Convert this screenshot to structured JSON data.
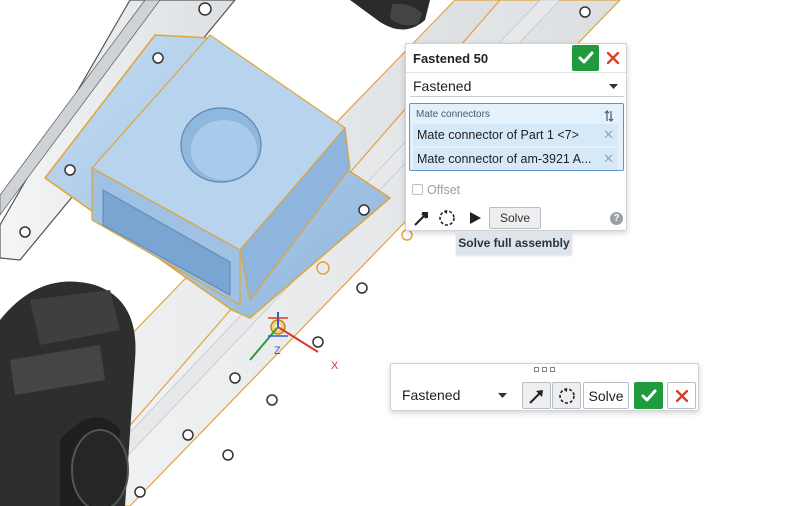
{
  "viewport": {
    "axis_label_x": "X",
    "axis_label_z": "Z"
  },
  "dialog": {
    "title": "Fastened 50",
    "mate_type": "Fastened",
    "connectors_label": "Mate connectors",
    "connectors": [
      "Mate connector of Part 1 <7>",
      "Mate connector of am-3921 A..."
    ],
    "offset_label": "Offset",
    "offset_checked": false,
    "solve_label": "Solve",
    "accept_color": "#1f9a3c",
    "cancel_color": "#d9402a"
  },
  "tooltip": {
    "text": "Solve full assembly"
  },
  "mini_toolbar": {
    "mate_type": "Fastened",
    "solve_label": "Solve"
  },
  "colors": {
    "part_highlight": "#a9c9e8",
    "selection_outline": "#e0a43a",
    "rail": "#eceef0"
  }
}
